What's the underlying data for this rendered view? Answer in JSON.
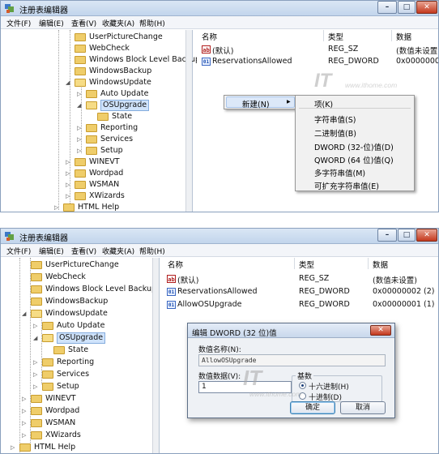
{
  "window": {
    "title": "注册表编辑器",
    "controls": {
      "minimize": "–",
      "maximize": "□",
      "close": "✕"
    }
  },
  "menu": [
    "文件(F)",
    "编辑(E)",
    "查看(V)",
    "收藏夹(A)",
    "帮助(H)"
  ],
  "tree_top": [
    "UserPictureChange",
    "WebCheck",
    "Windows Block Level Backup",
    "WindowsBackup",
    "WindowsUpdate",
    "Auto Update",
    "OSUpgrade",
    "State",
    "Reporting",
    "Services",
    "Setup",
    "WINEVT",
    "Wordpad",
    "WSMAN",
    "XWizards",
    "HTML Help"
  ],
  "tree_bottom": [
    "UserPictureChange",
    "WebCheck",
    "Windows Block Level Backup",
    "WindowsBackup",
    "WindowsUpdate",
    "Auto Update",
    "OSUpgrade",
    "State",
    "Reporting",
    "Services",
    "Setup",
    "WINEVT",
    "Wordpad",
    "WSMAN",
    "XWizards",
    "HTML Help"
  ],
  "columns": {
    "name": "名称",
    "type": "类型",
    "data": "数据"
  },
  "values_top": [
    {
      "icon": "ab",
      "name": "(默认)",
      "type": "REG_SZ",
      "data": "(数值未设置"
    },
    {
      "icon": "bin",
      "name": "ReservationsAllowed",
      "type": "REG_DWORD",
      "data": "0x0000000"
    }
  ],
  "values_bottom": [
    {
      "icon": "ab",
      "name": "(默认)",
      "type": "REG_SZ",
      "data": "(数值未设置)"
    },
    {
      "icon": "bin",
      "name": "ReservationsAllowed",
      "type": "REG_DWORD",
      "data": "0x00000002 (2)"
    },
    {
      "icon": "bin",
      "name": "AllowOSUpgrade",
      "type": "REG_DWORD",
      "data": "0x00000001 (1)"
    }
  ],
  "context_menu": {
    "new_label": "新建(N)",
    "submenu_arrow": "▶",
    "items": [
      "项(K)",
      "字符串值(S)",
      "二进制值(B)",
      "DWORD (32-位)值(D)",
      "QWORD (64 位)值(Q)",
      "多字符串值(M)",
      "可扩充字符串值(E)"
    ]
  },
  "watermark": {
    "logo": "IT",
    "site": "www.ithome.com"
  },
  "dialog": {
    "title": "编辑 DWORD (32 位)值",
    "close": "✕",
    "name_label": "数值名称(N):",
    "name_value": "AllowOSUpgrade",
    "data_label": "数值数据(V):",
    "data_value": "1",
    "base_label": "基数",
    "hex_label": "十六进制(H)",
    "dec_label": "十进制(D)",
    "hex_selected": true,
    "ok": "确定",
    "cancel": "取消"
  }
}
